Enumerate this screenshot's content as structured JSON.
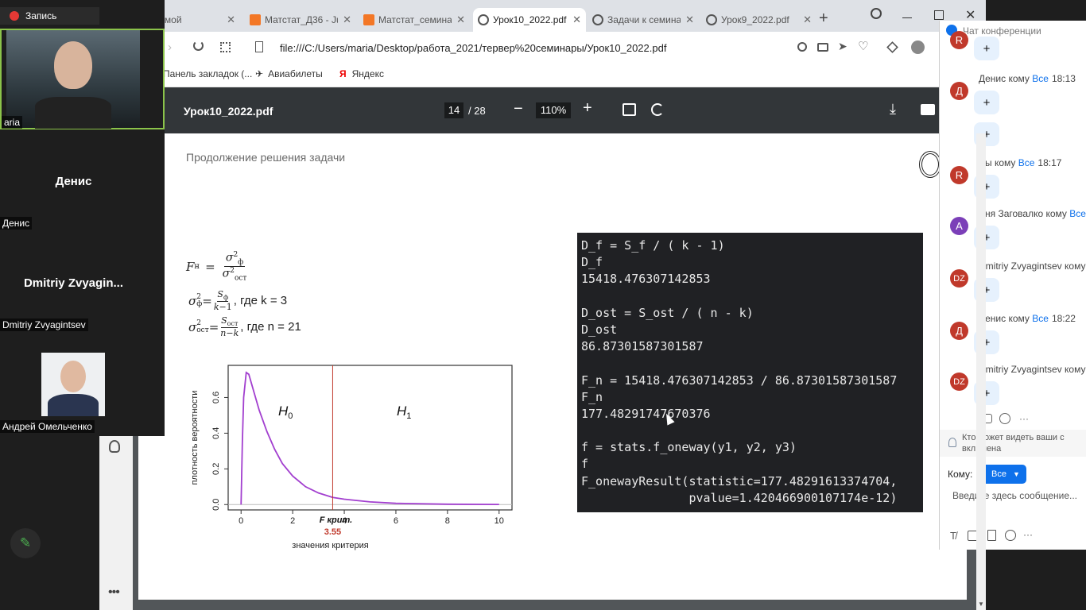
{
  "recording": {
    "label": "Запись"
  },
  "browser": {
    "tabs": [
      {
        "label": "Домой",
        "icon": "opera-icon"
      },
      {
        "label": "Матстат_Д36 - Ju",
        "icon": "jupyter-icon"
      },
      {
        "label": "Матстат_семинар",
        "icon": "jupyter-icon"
      },
      {
        "label": "Урок10_2022.pdf",
        "icon": "globe-icon",
        "active": true
      },
      {
        "label": "Задачи к семина",
        "icon": "globe-icon"
      },
      {
        "label": "Урок9_2022.pdf",
        "icon": "globe-icon"
      }
    ],
    "address": "file:///C:/Users/maria/Desktop/работа_2021/тервер%20семинары/Урок10_2022.pdf",
    "bookmarks": [
      "Панель закладок (...",
      "Авиабилеты",
      "Яндекс"
    ]
  },
  "pdf": {
    "filename": "Урок10_2022.pdf",
    "page_current": "14",
    "page_total": "/ 28",
    "zoom": "110%",
    "slide_title": "Продолжение решения задачи",
    "formula1_lhs": "F",
    "formula1_sub": "н",
    "formula2_where": ", где k = 3",
    "formula3_where": ", где n = 21",
    "code_lines": [
      "D_f = S_f / ( k - 1)",
      "D_f",
      "15418.476307142853",
      "",
      "D_ost = S_ost / ( n - k)",
      "D_ost",
      "86.87301587301587",
      "",
      "F_n = 15418.476307142853 / 86.87301587301587",
      "F_n",
      "177.48291747670376",
      "",
      "f = stats.f_oneway(y1, y2, y3)",
      "f",
      "F_onewayResult(statistic=177.48291613374704,",
      "               pvalue=1.420466900107174e-12)"
    ],
    "chart_data": {
      "type": "line",
      "xlabel": "значения критерия",
      "ylabel": "плотность вероятности",
      "x_ticks": [
        "0",
        "2",
        "4",
        "6",
        "8",
        "10"
      ],
      "y_ticks": [
        "0.0",
        "0.2",
        "0.4",
        "0.6"
      ],
      "xlim": [
        -0.5,
        10.5
      ],
      "ylim": [
        -0.03,
        0.78
      ],
      "series": [
        {
          "x": [
            0,
            0.05,
            0.1,
            0.2,
            0.3,
            0.5,
            0.7,
            1.0,
            1.3,
            1.6,
            2.0,
            2.5,
            3.0,
            3.55,
            4.0,
            5.0,
            6.0,
            8.0,
            10.0
          ],
          "y": [
            0,
            0.35,
            0.6,
            0.74,
            0.73,
            0.63,
            0.53,
            0.41,
            0.31,
            0.23,
            0.16,
            0.1,
            0.065,
            0.04,
            0.03,
            0.015,
            0.007,
            0.002,
            0.0005
          ]
        }
      ],
      "critical_line": 3.55,
      "critical_label": "F крит.",
      "critical_value": "3.55",
      "region_left": "H",
      "region_left_sub": "0",
      "region_right": "H",
      "region_right_sub": "1"
    }
  },
  "participants": [
    {
      "name": "maria",
      "short": "aria",
      "video": true
    },
    {
      "display": "Денис",
      "name": "Денис"
    },
    {
      "display": "Dmitriy  Zvyagin...",
      "name": "Dmitriy Zvyagintsev"
    },
    {
      "name": "Андрей Омельченко",
      "video": true
    }
  ],
  "chat": {
    "title": "Чат конференции",
    "messages": [
      {
        "avatar": "R",
        "color": "#c0392b",
        "sender": "",
        "to": "",
        "time": "",
        "text": "+",
        "top": 26
      },
      {
        "avatar": "Д",
        "color": "#c0392b",
        "sender": "Денис кому",
        "to": "Все",
        "time": "18:13",
        "text": "+",
        "top": 66
      },
      {
        "avatar": "R",
        "color": "#c0392b",
        "sender": "Вы кому",
        "to": "Все",
        "time": "18:17",
        "text": "+",
        "top": 172
      },
      {
        "avatar": "A",
        "color": "#7b3fb8",
        "sender": "Аня Заговалко кому",
        "to": "Все",
        "time": "",
        "text": "+",
        "top": 236
      },
      {
        "avatar": "DZ",
        "color": "#c0392b",
        "sender": "Dmitriy Zvyagintsev кому",
        "to": "",
        "time": "",
        "text": "+",
        "top": 302
      },
      {
        "avatar": "Д",
        "color": "#c0392b",
        "sender": "Денис кому",
        "to": "Все",
        "time": "18:22",
        "text": "+",
        "top": 368
      },
      {
        "avatar": "DZ",
        "color": "#c0392b",
        "sender": "Dmitriy Zvyagintsev кому",
        "to": "",
        "time": "",
        "text": "+",
        "top": 432
      }
    ],
    "privacy_note": "Кто может видеть ваши с включена",
    "to_label": "Кому:",
    "to_value": "Все",
    "input_placeholder": "Введите здесь сообщение..."
  }
}
